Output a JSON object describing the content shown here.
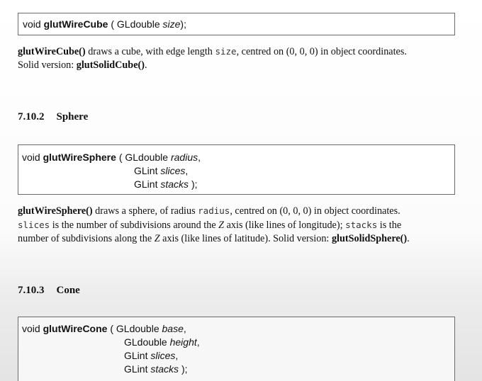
{
  "cube": {
    "sig_void": "void",
    "sig_fn": "glutWireCube",
    "sig_open": "( GLdouble",
    "sig_param": "size",
    "sig_close": ");",
    "desc_fn": "glutWireCube()",
    "desc_a": " draws a cube, with edge length ",
    "desc_code": "size",
    "desc_b": ", centred on ",
    "desc_math": "(0, 0, 0)",
    "desc_c": " in object coordinates.",
    "solid_label": "Solid version: ",
    "solid_fn": "glutSolidCube()",
    "solid_end": "."
  },
  "sphere": {
    "heading_num": "7.10.2",
    "heading_name": "Sphere",
    "sig_void": "void",
    "sig_fn": "glutWireSphere",
    "sig_open": "( GLdouble",
    "sig_p1": "radius",
    "sig_p1_end": ",",
    "sig_t2": "GLint",
    "sig_p2": "slices",
    "sig_p2_end": ",",
    "sig_t3": "GLint",
    "sig_p3": "stacks",
    "sig_close": ");",
    "desc_fn": "glutWireSphere()",
    "desc_a": " draws a sphere, of radius ",
    "desc_code1": "radius",
    "desc_b": ", centred on ",
    "desc_math": "(0, 0, 0)",
    "desc_c": " in object coordinates.",
    "line2_code": "slices",
    "line2_a": " is the number of subdivisions around the ",
    "line2_var": "Z",
    "line2_b": " axis (like lines of longitude); ",
    "line2_code2": "stacks",
    "line2_c": " is the",
    "line3_a": "number of subdivisions along the ",
    "line3_var": "Z",
    "line3_b": " axis (like lines of latitude). Solid version: ",
    "solid_fn": "glutSolidSphere()",
    "solid_end": "."
  },
  "cone": {
    "heading_num": "7.10.3",
    "heading_name": "Cone",
    "sig_void": "void",
    "sig_fn": "glutWireCone",
    "sig_open": "( GLdouble",
    "sig_p1": "base",
    "sig_p1_end": ",",
    "sig_t2": "GLdouble",
    "sig_p2": "height",
    "sig_p2_end": ",",
    "sig_t3": "GLint",
    "sig_p3": "slices",
    "sig_p3_end": ",",
    "sig_t4": "GLint",
    "sig_p4": "stacks",
    "sig_close": ");"
  }
}
